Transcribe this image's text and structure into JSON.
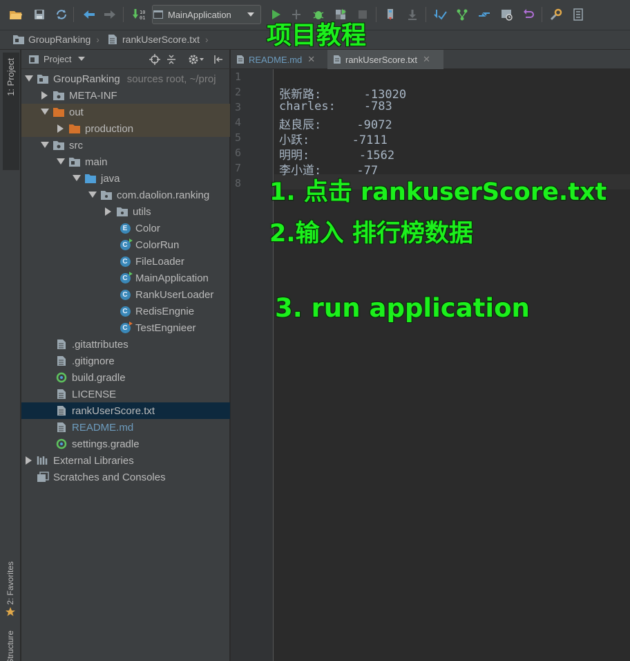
{
  "toolbar": {
    "run_config": "MainApplication",
    "icons": [
      "open-icon",
      "save-icon",
      "sync-icon",
      "back-icon",
      "forward-icon",
      "build-icon",
      "run-icon",
      "debug-icon",
      "bug-icon",
      "coverage-icon",
      "stop-icon",
      "attach-icon",
      "download-icon",
      "vcs-update-icon",
      "vcs-commit-icon",
      "vcs-push-icon",
      "history-icon",
      "revert-icon",
      "settings-icon",
      "structure-icon"
    ]
  },
  "breadcrumb": {
    "project": "GroupRanking",
    "file": "rankUserScore.txt"
  },
  "left_strip": {
    "project_tab": "1: Project",
    "favorites_tab": "2: Favorites",
    "structure_tab": "Structure"
  },
  "project_panel": {
    "title": "Project",
    "tree": [
      {
        "label": "GroupRanking",
        "note": "sources root, ~/proj"
      },
      {
        "label": "META-INF"
      },
      {
        "label": "out"
      },
      {
        "label": "production"
      },
      {
        "label": "src"
      },
      {
        "label": "main"
      },
      {
        "label": "java"
      },
      {
        "label": "com.daolion.ranking"
      },
      {
        "label": "utils"
      },
      {
        "label": "Color",
        "badge": "E"
      },
      {
        "label": "ColorRun",
        "badge": "C"
      },
      {
        "label": "FileLoader",
        "badge": "C"
      },
      {
        "label": "MainApplication",
        "badge": "C"
      },
      {
        "label": "RankUserLoader",
        "badge": "C"
      },
      {
        "label": "RedisEngnie",
        "badge": "C"
      },
      {
        "label": "TestEngnieer",
        "badge": "C"
      },
      {
        "label": ".gitattributes"
      },
      {
        "label": ".gitignore"
      },
      {
        "label": "build.gradle"
      },
      {
        "label": "LICENSE"
      },
      {
        "label": "rankUserScore.txt"
      },
      {
        "label": "README.md"
      },
      {
        "label": "settings.gradle"
      },
      {
        "label": "External Libraries"
      },
      {
        "label": "Scratches and Consoles"
      }
    ]
  },
  "editor": {
    "tabs": [
      {
        "label": "README.md"
      },
      {
        "label": "rankUserScore.txt"
      }
    ],
    "line_numbers": [
      "1",
      "2",
      "3",
      "4",
      "5",
      "6",
      "7",
      "8"
    ],
    "lines": [
      "",
      "张新路:      -13020",
      "charles:    -783",
      "赵良辰:     -9072",
      "小跃:      -7111",
      "明明:       -1562",
      "李小道:     -77",
      ""
    ]
  },
  "annotations": {
    "title": "项目教程",
    "step1": "1. 点击   rankuserScore.txt",
    "step2": "2.输入    排行榜数据",
    "step3": "3. run application"
  },
  "colors": {
    "annotation": "#1cf01c",
    "selection": "#0d293e",
    "folder_orange": "#d4722b",
    "class_badge": "#3a88b8"
  }
}
